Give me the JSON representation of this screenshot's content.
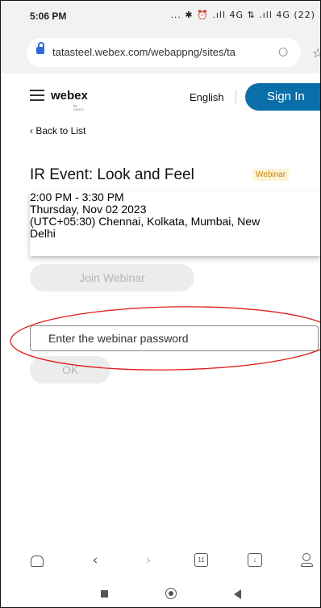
{
  "status_bar": {
    "time": "5:06 PM",
    "icons_text": "... ✱ ⏰ .ıll 4G ⇅ .ıll 4G (22)",
    "battery": "22"
  },
  "browser": {
    "url": "tatasteel.webex.com/webappng/sites/ta",
    "lock_icon": "lock-icon",
    "reload_icon": "reload-icon",
    "share_icon": "share-icon"
  },
  "header": {
    "brand": "webex",
    "brand_sub": "by CISCO",
    "language": "English",
    "sign_in": "Sign In",
    "accent": "#0a6fa9"
  },
  "page": {
    "back_link": "‹ Back to List",
    "title": "IR Event: Look and Feel",
    "badge": "Webinar",
    "time_range": "2:00 PM -  3:30 PM",
    "date": "Thursday, Nov 02 2023",
    "timezone_line1": "(UTC+05:30) Chennai, Kolkata, Mumbai, New",
    "timezone_line2": "Delhi",
    "join_button": "Join Webinar",
    "password_placeholder": "Enter the webinar password",
    "ok_button": "OK"
  },
  "annotation": {
    "ellipse_color": "#e01b1b"
  },
  "browser_nav": {
    "home": "home-icon",
    "back": "‹",
    "forward": "›",
    "tabs_count": "11",
    "downloads": "download-icon",
    "profile": "profile-icon"
  },
  "system_nav": {
    "recent": "recent-apps-icon",
    "home": "home-circle-icon",
    "back": "back-triangle-icon"
  }
}
